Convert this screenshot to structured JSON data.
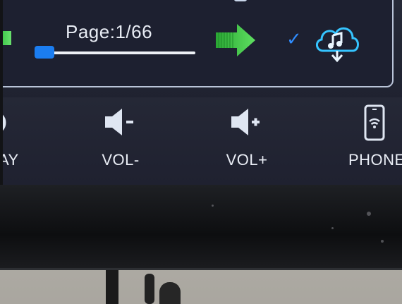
{
  "player": {
    "page_label": "Page:1/66",
    "page_progress": 0.015
  },
  "controls": [
    {
      "id": "play",
      "label": "AY",
      "icon": "play-icon"
    },
    {
      "id": "vol_down",
      "label": "VOL-",
      "icon": "volume-down-icon"
    },
    {
      "id": "vol_up",
      "label": "VOL+",
      "icon": "volume-up-icon"
    },
    {
      "id": "phone",
      "label": "PHONE",
      "icon": "phone-wifi-icon"
    }
  ],
  "icons": {
    "next": "next-arrow-icon",
    "check": "checkmark-icon",
    "download": "cloud-music-download-icon",
    "star": "star-icon",
    "top_phone": "phone-icon"
  },
  "colors": {
    "accent_blue": "#2f8cff",
    "arrow_green": "#39c843",
    "text": "#e9edf5"
  }
}
